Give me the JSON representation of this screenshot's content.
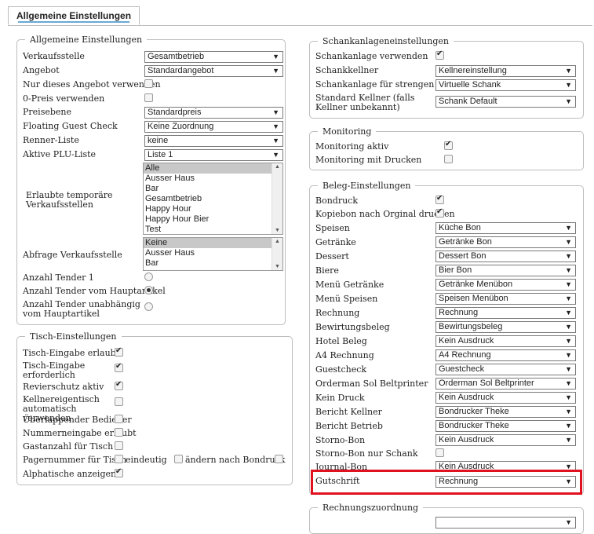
{
  "tab": {
    "label": "Allgemeine Einstellungen"
  },
  "general": {
    "legend": "Allgemeine Einstellungen",
    "verkaufsstelle": {
      "label": "Verkaufsstelle",
      "value": "Gesamtbetrieb"
    },
    "angebot": {
      "label": "Angebot",
      "value": "Standardangebot"
    },
    "nur_angebot": {
      "label": "Nur dieses Angebot verwenden",
      "checked": false
    },
    "null_preis": {
      "label": "0-Preis verwenden",
      "checked": false
    },
    "preisebene": {
      "label": "Preisebene",
      "value": "Standardpreis"
    },
    "floating": {
      "label": "Floating Guest Check",
      "value": "Keine Zuordnung"
    },
    "renner": {
      "label": "Renner-Liste",
      "value": "keine"
    },
    "plu": {
      "label": "Aktive PLU-Liste",
      "value": "Liste 1"
    },
    "temp_stellen": {
      "label": "Erlaubte temporäre Verkaufsstellen",
      "items": [
        "Alle",
        "Ausser Haus",
        "Bar",
        "Gesamtbetrieb",
        "Happy Hour",
        "Happy Hour Bier",
        "Test"
      ]
    },
    "abfrage": {
      "label": "Abfrage Verkaufsstelle",
      "items": [
        "Keine",
        "Ausser Haus",
        "Bar"
      ]
    },
    "tender1": {
      "label": "Anzahl Tender 1"
    },
    "tender_haupt": {
      "label": "Anzahl Tender vom Hauptartikel"
    },
    "tender_unab": {
      "label": "Anzahl Tender unabhängig vom Hauptartikel"
    }
  },
  "tisch": {
    "legend": "Tisch-Einstellungen",
    "eingabe": {
      "label": "Tisch-Eingabe erlaubt"
    },
    "erforderlich": {
      "label": "Tisch-Eingabe erforderlich"
    },
    "revierschutz": {
      "label": "Revierschutz aktiv"
    },
    "kellnereigen": {
      "label": "Kellnereigentisch automatisch verwenden"
    },
    "ueberlappend": {
      "label": "Überlappender Bediener"
    },
    "nummern": {
      "label": "Nummerneingabe erlaubt"
    },
    "gastanzahl": {
      "label": "Gastanzahl für Tisch"
    },
    "pager": {
      "label": "Pagernummer für Tisch",
      "opt1": "eindeutig",
      "opt2": "ändern nach Bondruck"
    },
    "alpha": {
      "label": "Alphatische anzeigen"
    }
  },
  "schank": {
    "legend": "Schankanlageneinstellungen",
    "verwenden": {
      "label": "Schankanlage verwenden"
    },
    "kellner": {
      "label": "Schankkellner",
      "value": "Kellnereinstellung"
    },
    "strengen": {
      "label": "Schankanlage für strengen Kredit",
      "value": "Virtuelle Schank"
    },
    "standard": {
      "label": "Standard Kellner (falls Kellner unbekannt)",
      "value": "Schank Default"
    }
  },
  "monitoring": {
    "legend": "Monitoring",
    "aktiv": {
      "label": "Monitoring aktiv"
    },
    "drucken": {
      "label": "Monitoring mit Drucken"
    }
  },
  "beleg": {
    "legend": "Beleg-Einstellungen",
    "bondruck": {
      "label": "Bondruck"
    },
    "kopiebon": {
      "label": "Kopiebon nach Orginal drucken"
    },
    "speisen": {
      "label": "Speisen",
      "value": "Küche Bon"
    },
    "getraenke": {
      "label": "Getränke",
      "value": "Getränke Bon"
    },
    "dessert": {
      "label": "Dessert",
      "value": "Dessert Bon"
    },
    "biere": {
      "label": "Biere",
      "value": "Bier Bon"
    },
    "menu_getraenke": {
      "label": "Menü Getränke",
      "value": "Getränke Menübon"
    },
    "menu_speisen": {
      "label": "Menü Speisen",
      "value": "Speisen Menübon"
    },
    "rechnung": {
      "label": "Rechnung",
      "value": "Rechnung"
    },
    "bewirtung": {
      "label": "Bewirtungsbeleg",
      "value": "Bewirtungsbeleg"
    },
    "hotel": {
      "label": "Hotel Beleg",
      "value": "Kein Ausdruck"
    },
    "a4": {
      "label": "A4 Rechnung",
      "value": "A4 Rechnung"
    },
    "guestcheck": {
      "label": "Guestcheck",
      "value": "Guestcheck"
    },
    "orderman": {
      "label": "Orderman Sol Beltprinter",
      "value": "Orderman Sol Beltprinter"
    },
    "kein_druck": {
      "label": "Kein Druck",
      "value": "Kein Ausdruck"
    },
    "bericht_kellner": {
      "label": "Bericht Kellner",
      "value": "Bondrucker Theke"
    },
    "bericht_betrieb": {
      "label": "Bericht Betrieb",
      "value": "Bondrucker Theke"
    },
    "storno": {
      "label": "Storno-Bon",
      "value": "Kein Ausdruck"
    },
    "storno_schank": {
      "label": "Storno-Bon nur Schank"
    },
    "journal": {
      "label": "Journal-Bon",
      "value": "Kein Ausdruck"
    },
    "gutschrift": {
      "label": "Gutschrift",
      "value": "Rechnung"
    }
  },
  "rechnung": {
    "legend": "Rechnungszuordnung"
  },
  "colors": {
    "highlight": "#e0121f",
    "tab_accent": "#6aa8d6"
  }
}
